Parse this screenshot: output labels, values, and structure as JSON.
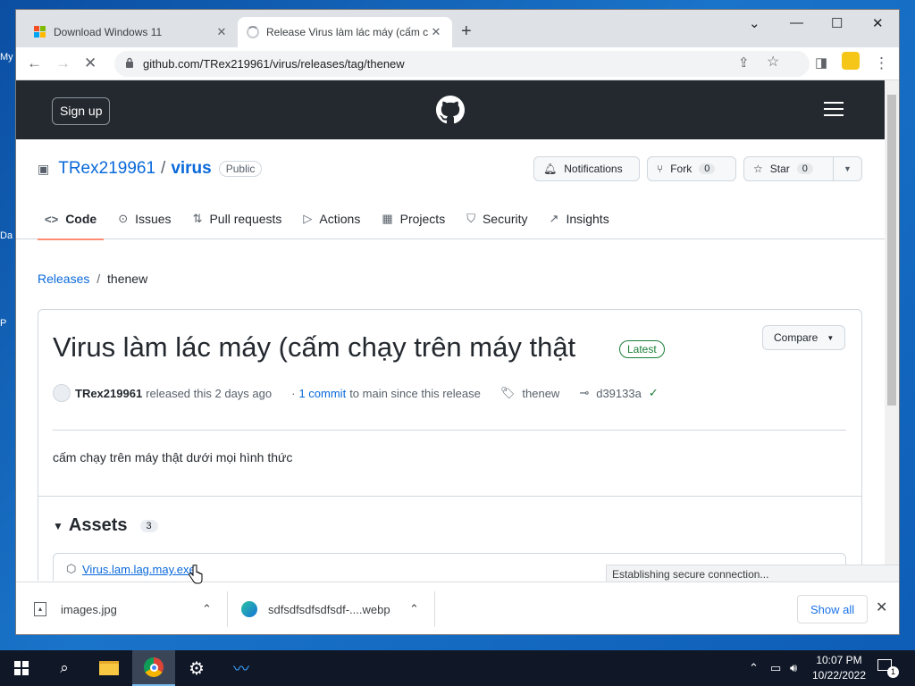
{
  "desktop": {
    "edge_labels": [
      "My",
      "Da",
      "P"
    ]
  },
  "browser": {
    "tabs": [
      {
        "title": "Download Windows 11",
        "close": "✕"
      },
      {
        "title": "Release Virus làm lác máy (cấm c",
        "close": "✕"
      }
    ],
    "new_tab": "+",
    "window_controls": {
      "dropdown": "⌄",
      "minimize": "—",
      "maximize": "☐",
      "close": "✕"
    },
    "url": "github.com/TRex219961/virus/releases/tag/thenew",
    "status_popup": "Establishing secure connection..."
  },
  "github": {
    "signup_label": "Sign up",
    "repo_owner": "TRex219961",
    "repo_sep": "/",
    "repo_name": "virus",
    "visibility": "Public",
    "notifications_label": "Notifications",
    "fork_label": "Fork",
    "fork_count": "0",
    "star_label": "Star",
    "star_count": "0",
    "nav": [
      {
        "label": "Code",
        "icon": "<>"
      },
      {
        "label": "Issues",
        "icon": "⊙"
      },
      {
        "label": "Pull requests",
        "icon": "⇅"
      },
      {
        "label": "Actions",
        "icon": "▷"
      },
      {
        "label": "Projects",
        "icon": "▦"
      },
      {
        "label": "Security",
        "icon": "⛉"
      },
      {
        "label": "Insights",
        "icon": "↗"
      }
    ],
    "breadcrumb": {
      "releases": "Releases",
      "sep": "/",
      "current": "thenew"
    },
    "release": {
      "title": "Virus làm lác máy (cấm chạy trên máy thật",
      "latest_badge": "Latest",
      "compare_label": "Compare",
      "author": "TRex219961",
      "released_text": "released this 2 days ago",
      "commit_prefix": "·",
      "commit_link": "1 commit",
      "commit_suffix": "to main since this release",
      "tag": "thenew",
      "commit_hash": "d39133a",
      "description": "cấm chạy trên máy thật dưới mọi hình thức",
      "assets_label": "Assets",
      "assets_count": "3",
      "asset_name": "Virus.lam.lag.may.exe"
    }
  },
  "downloads": {
    "items": [
      {
        "name": "images.jpg",
        "chevron": "⌃"
      },
      {
        "name": "sdfsdfsdfsdfsdf-....webp",
        "chevron": "⌃"
      }
    ],
    "show_all": "Show all",
    "close": "✕"
  },
  "taskbar": {
    "time": "10:07 PM",
    "date": "10/22/2022",
    "notification_count": "1"
  }
}
